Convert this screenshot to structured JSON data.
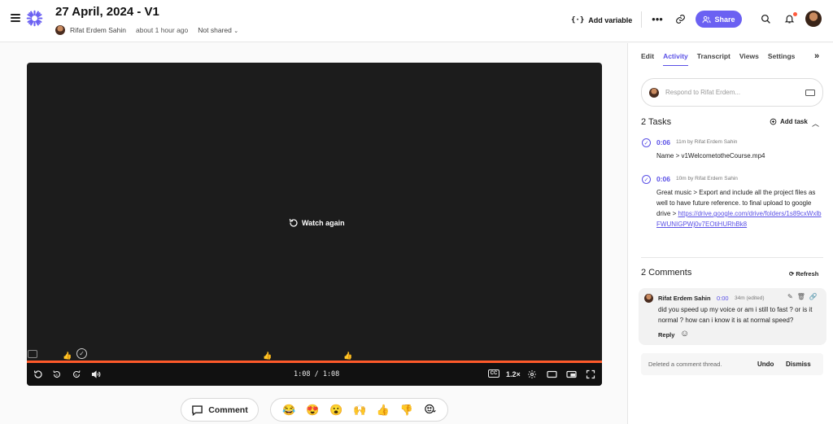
{
  "header": {
    "title": "27 April, 2024 - V1",
    "author": "Rifat Erdem Sahin",
    "time_ago": "about 1 hour ago",
    "sharing": "Not shared",
    "add_variable_label": "Add variable",
    "share_label": "Share",
    "icons": [
      "menu-icon",
      "logo-icon",
      "more-icon",
      "link-icon",
      "search-icon",
      "bell-icon"
    ]
  },
  "video": {
    "overlay_label": "Watch again",
    "current_time": "1:08",
    "duration": "1:08",
    "time_display": "1:08 / 1:08",
    "speed": "1.2×",
    "cc_label": "CC",
    "progress": 1.0,
    "progress_color": "#ff5a2a"
  },
  "bottom": {
    "comment_label": "Comment",
    "reactions": [
      "😂",
      "😍",
      "😮",
      "🙌",
      "👍",
      "👎"
    ]
  },
  "sidebar": {
    "tabs": [
      {
        "label": "Edit",
        "active": false
      },
      {
        "label": "Activity",
        "active": true
      },
      {
        "label": "Transcript",
        "active": false
      },
      {
        "label": "Views",
        "active": false
      },
      {
        "label": "Settings",
        "active": false
      }
    ],
    "respond_placeholder": "Respond to Rifat Erdem...",
    "tasks_title": "2 Tasks",
    "add_task_label": "Add task",
    "tasks": [
      {
        "timestamp": "0:06",
        "by": "11m by Rifat Erdem Sahin",
        "text": "Name > v1WelcometotheCourse.mp4",
        "link": ""
      },
      {
        "timestamp": "0:06",
        "by": "10m by Rifat Erdem Sahin",
        "text": "Great music > Export and include all the project files as well to have future reference. to final upload to google drive >",
        "link": "https://drive.google.com/drive/folders/1s89cxWxlbFWUNIGPWj0v7EOtiHURhBk8"
      }
    ],
    "comments_title": "2 Comments",
    "refresh_label": "Refresh",
    "comment": {
      "author": "Rifat Erdem Sahin",
      "timestamp": "0:00",
      "meta": "34m (edited)",
      "text": "did you speed up my voice or am i still to fast ? or is it normal ? how can i know it is at normal speed?",
      "reply_label": "Reply"
    },
    "deleted_notice": "Deleted a comment thread.",
    "undo_label": "Undo",
    "dismiss_label": "Dismiss"
  },
  "colors": {
    "accent": "#5a50e6",
    "share_bg": "#6b61f2",
    "notification": "#ff5a3c"
  }
}
